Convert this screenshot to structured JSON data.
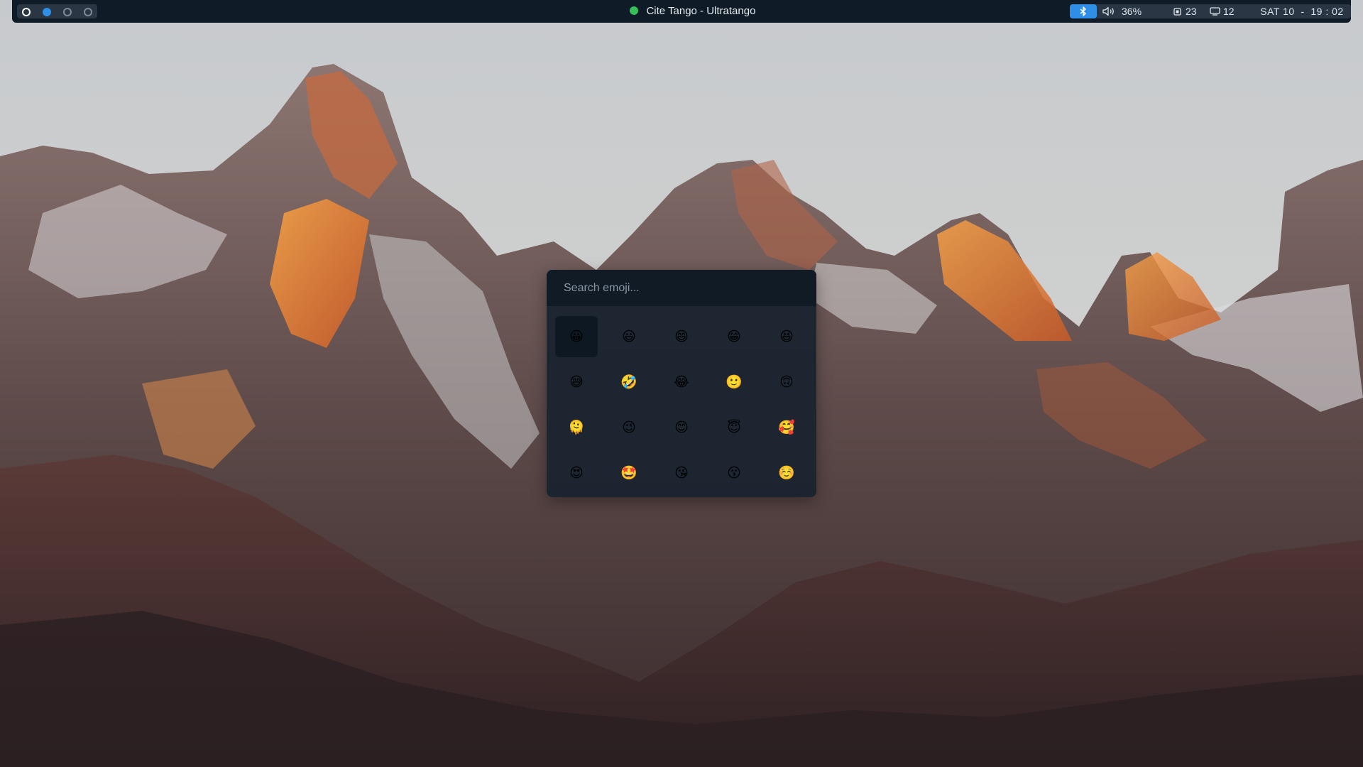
{
  "topbar": {
    "workspaces": [
      {
        "name": "workspace-1",
        "state": "current"
      },
      {
        "name": "workspace-2",
        "state": "occupied"
      },
      {
        "name": "workspace-3",
        "state": "empty"
      },
      {
        "name": "workspace-4",
        "state": "empty"
      }
    ],
    "window_title": "Cite Tango - Ultratango",
    "volume": "36%",
    "cpu": "23",
    "windows": "12",
    "clock": "SAT 10  -  19 : 02",
    "icons": {
      "music": "spotify-icon",
      "bluetooth": "bluetooth-icon",
      "volume": "speaker-icon",
      "cpu": "cpu-icon",
      "windows": "screen-icon"
    },
    "colors": {
      "bar_bg": "#0f1b27",
      "pill_bg": "#2a3644",
      "accent": "#2f8fe6",
      "music_dot": "#35c05a"
    }
  },
  "emoji_picker": {
    "search_placeholder": "Search emoji...",
    "selected_index": 0,
    "emojis": [
      "😀",
      "😃",
      "😄",
      "😁",
      "😆",
      "😅",
      "🤣",
      "😂",
      "🙂",
      "🙃",
      "🫠",
      "😉",
      "😊",
      "😇",
      "🥰",
      "😍",
      "🤩",
      "😘",
      "😗",
      "☺️"
    ]
  }
}
